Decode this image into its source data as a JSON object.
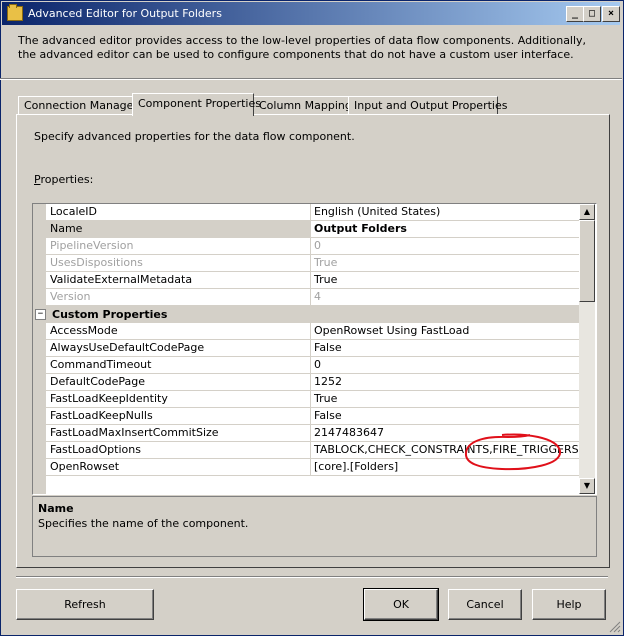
{
  "window": {
    "title": "Advanced Editor for Output Folders",
    "min_label": "_",
    "max_label": "□",
    "close_label": "×"
  },
  "description": "The advanced editor provides access to the low-level properties of data flow components. Additionally, the advanced editor can be used to configure components that do not have a custom user interface.",
  "tabs": [
    {
      "label": "Connection Managers"
    },
    {
      "label": "Component Properties"
    },
    {
      "label": "Column Mappings"
    },
    {
      "label": "Input and Output Properties"
    }
  ],
  "panel": {
    "description": "Specify advanced properties for the data flow component.",
    "properties_label_prefix": "P",
    "properties_label_rest": "roperties:"
  },
  "grid": {
    "rows": [
      {
        "name": "LocaleID",
        "value": "English (United States)"
      },
      {
        "name": "Name",
        "value": "Output Folders"
      },
      {
        "name": "PipelineVersion",
        "value": "0"
      },
      {
        "name": "UsesDispositions",
        "value": "True"
      },
      {
        "name": "ValidateExternalMetadata",
        "value": "True"
      },
      {
        "name": "Version",
        "value": "4"
      }
    ],
    "category": {
      "toggle": "−",
      "label": "Custom Properties"
    },
    "custom_rows": [
      {
        "name": "AccessMode",
        "value": "OpenRowset Using FastLoad"
      },
      {
        "name": "AlwaysUseDefaultCodePage",
        "value": "False"
      },
      {
        "name": "CommandTimeout",
        "value": "0"
      },
      {
        "name": "DefaultCodePage",
        "value": "1252"
      },
      {
        "name": "FastLoadKeepIdentity",
        "value": "True"
      },
      {
        "name": "FastLoadKeepNulls",
        "value": "False"
      },
      {
        "name": "FastLoadMaxInsertCommitSize",
        "value": "2147483647"
      },
      {
        "name": "FastLoadOptions",
        "value": "TABLOCK,CHECK_CONSTRAINTS,FIRE_TRIGGERS"
      },
      {
        "name": "OpenRowset",
        "value": "[core].[Folders]"
      }
    ],
    "scroll_up": "▲",
    "scroll_down": "▼"
  },
  "help": {
    "title": "Name",
    "text": "Specifies the name of the component."
  },
  "buttons": {
    "refresh": "Refresh",
    "ok": "OK",
    "cancel": "Cancel",
    "help": "Help"
  },
  "colors": {
    "title_bar_start": "#0a246a",
    "title_bar_end": "#a6caf0",
    "annotation": "#e0101a"
  }
}
